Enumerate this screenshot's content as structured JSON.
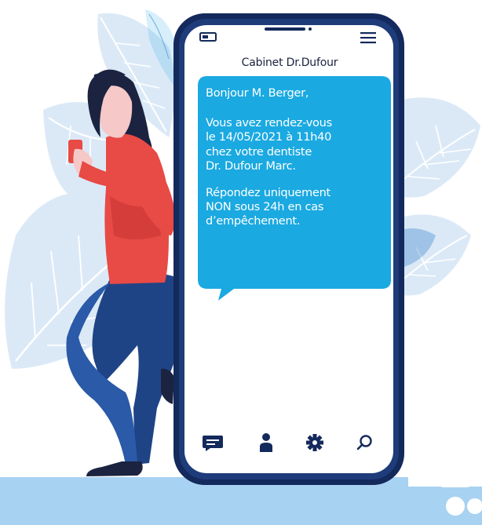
{
  "app": {
    "contact_name": "Cabinet Dr.Dufour"
  },
  "message": {
    "greeting": "Bonjour M. Berger,",
    "appointment_lines": [
      "Vous avez rendez-vous",
      "le 14/05/2021 à 11h40",
      "chez votre dentiste",
      "Dr. Dufour Marc."
    ],
    "instruction_lines": [
      "Répondez uniquement",
      "NON sous 24h en cas",
      "d’empêchement."
    ]
  },
  "bottom_nav": {
    "items": [
      {
        "name": "messages",
        "icon": "chat-icon"
      },
      {
        "name": "profile",
        "icon": "user-icon"
      },
      {
        "name": "settings",
        "icon": "gear-icon"
      },
      {
        "name": "search",
        "icon": "search-icon"
      }
    ]
  },
  "colors": {
    "phone_frame": "#14295c",
    "bubble": "#1aa9e1",
    "leaves": "#dbe9f7",
    "leaf_veins": "#ffffff",
    "shirt": "#e84a45",
    "jeans": "#1f4486",
    "floor": "#a8d2f2"
  }
}
